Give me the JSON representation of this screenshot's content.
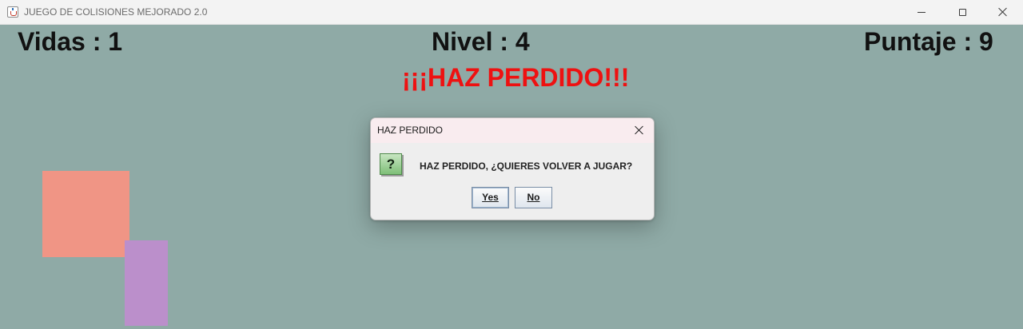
{
  "window": {
    "title": "JUEGO DE COLISIONES MEJORADO 2.0",
    "icon": "java-cup-icon",
    "controls": [
      "minimize-icon",
      "maximize-icon",
      "close-icon"
    ]
  },
  "hud": {
    "lives": "Vidas : 1",
    "level": "Nivel : 4",
    "score": "Puntaje : 9"
  },
  "status": {
    "message": "¡¡¡HAZ PERDIDO!!!",
    "color": "#ee1111"
  },
  "game": {
    "background": "#8faaa6",
    "player_color": "#f09585",
    "enemy_color": "#bb8fcb"
  },
  "dialog": {
    "title": "HAZ PERDIDO",
    "icon": "question-icon",
    "icon_glyph": "?",
    "message": "HAZ PERDIDO, ¿QUIERES VOLVER A JUGAR?",
    "yes_label": "Yes",
    "no_label": "No"
  }
}
